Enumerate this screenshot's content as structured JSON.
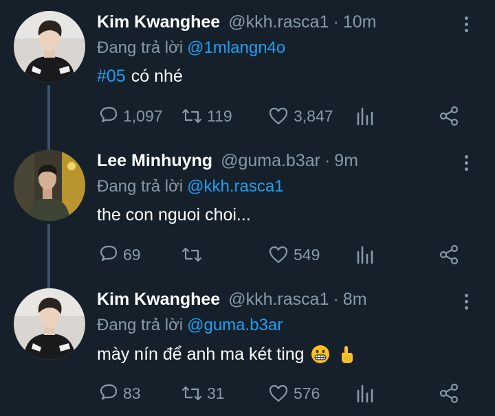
{
  "thread": [
    {
      "name": "Kim Kwanghee",
      "handle": "@kkh.rasca1",
      "time": "10m",
      "reply_prefix": "Đang trả lời",
      "reply_to": "@1mlangn4o",
      "hashtag": "#05",
      "text": "có nhé",
      "replies": "1,097",
      "retweets": "119",
      "likes": "3,847"
    },
    {
      "name": "Lee Minhuyng",
      "handle": "@guma.b3ar",
      "time": "9m",
      "reply_prefix": "Đang trả lời",
      "reply_to": "@kkh.rasca1",
      "text": "the con nguoi choi...",
      "replies": "69",
      "likes": "549"
    },
    {
      "name": "Kim Kwanghee",
      "handle": "@kkh.rasca1",
      "time": "8m",
      "reply_prefix": "Đang trả lời",
      "reply_to": "@guma.b3ar",
      "text": "mày nín để anh ma két ting",
      "emojis": [
        "grinning-face-emoji",
        "pointing-up-emoji"
      ],
      "replies": "83",
      "retweets": "31",
      "likes": "576"
    }
  ],
  "colors": {
    "background": "#15202b",
    "text": "#ffffff",
    "muted": "#8899a6",
    "link": "#1da1f2",
    "thread_line": "#3d5466"
  },
  "icons": [
    "reply-icon",
    "retweet-icon",
    "like-icon",
    "stats-icon",
    "share-icon",
    "more-icon"
  ]
}
